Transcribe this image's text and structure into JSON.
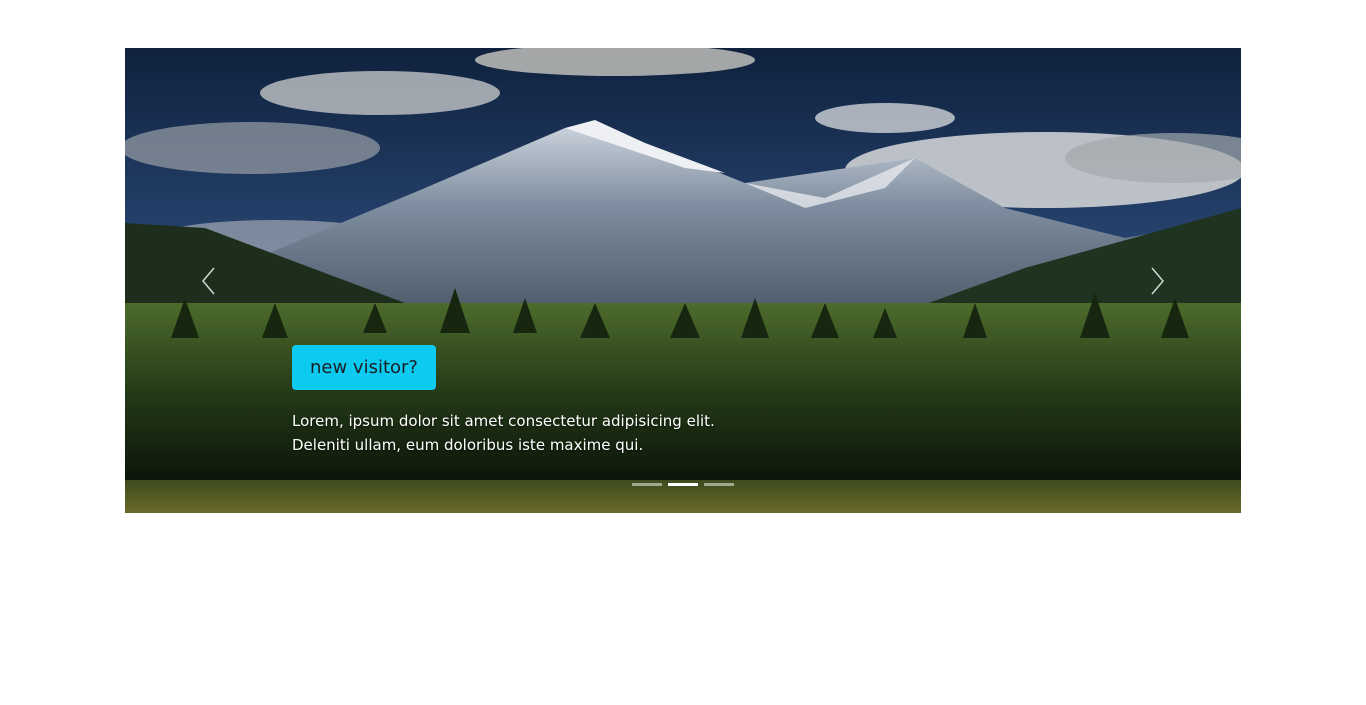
{
  "carousel": {
    "active_slide": 2,
    "slide_count": 3,
    "prev_icon": "chevron-left-icon",
    "next_icon": "chevron-right-icon",
    "caption": {
      "button_label": "new visitor?",
      "text": "Lorem, ipsum dolor sit amet consectetur adipisicing elit. Deleniti ullam, eum doloribus iste maxime qui."
    }
  },
  "colors": {
    "accent": "#0dcaf0",
    "background": "#ffffff"
  }
}
